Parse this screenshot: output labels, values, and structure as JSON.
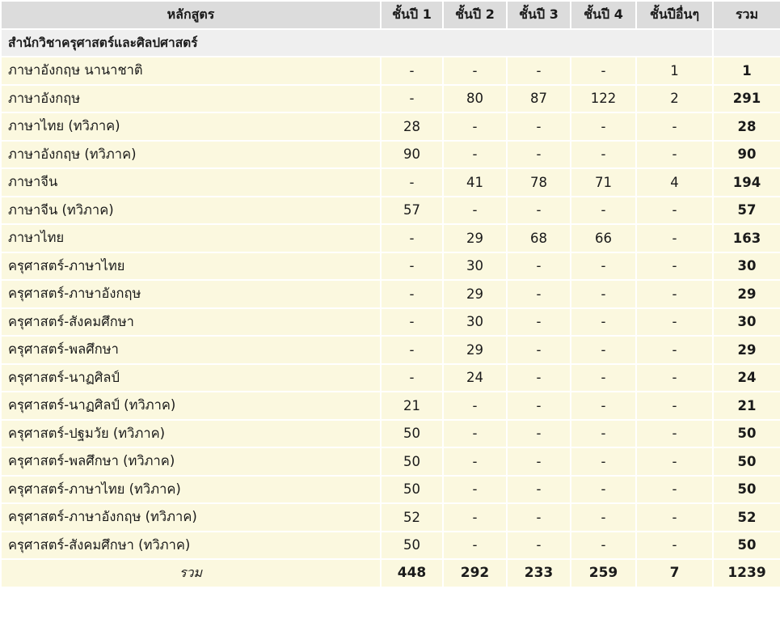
{
  "headers": [
    "หลักสูตร",
    "ชั้นปี 1",
    "ชั้นปี 2",
    "ชั้นปี 3",
    "ชั้นปี 4",
    "ชั้นปีอื่นๆ",
    "รวม"
  ],
  "section_title": "สำนักวิชาครุศาสตร์และศิลปศาสตร์",
  "rows": [
    {
      "program": "ภาษาอังกฤษ นานาชาติ",
      "y1": "-",
      "y2": "-",
      "y3": "-",
      "y4": "-",
      "other": "1",
      "total": "1"
    },
    {
      "program": "ภาษาอังกฤษ",
      "y1": "-",
      "y2": "80",
      "y3": "87",
      "y4": "122",
      "other": "2",
      "total": "291"
    },
    {
      "program": "ภาษาไทย (ทวิภาค)",
      "y1": "28",
      "y2": "-",
      "y3": "-",
      "y4": "-",
      "other": "-",
      "total": "28"
    },
    {
      "program": "ภาษาอังกฤษ (ทวิภาค)",
      "y1": "90",
      "y2": "-",
      "y3": "-",
      "y4": "-",
      "other": "-",
      "total": "90"
    },
    {
      "program": "ภาษาจีน",
      "y1": "-",
      "y2": "41",
      "y3": "78",
      "y4": "71",
      "other": "4",
      "total": "194"
    },
    {
      "program": "ภาษาจีน (ทวิภาค)",
      "y1": "57",
      "y2": "-",
      "y3": "-",
      "y4": "-",
      "other": "-",
      "total": "57"
    },
    {
      "program": "ภาษาไทย",
      "y1": "-",
      "y2": "29",
      "y3": "68",
      "y4": "66",
      "other": "-",
      "total": "163"
    },
    {
      "program": "ครุศาสตร์-ภาษาไทย",
      "y1": "-",
      "y2": "30",
      "y3": "-",
      "y4": "-",
      "other": "-",
      "total": "30"
    },
    {
      "program": "ครุศาสตร์-ภาษาอังกฤษ",
      "y1": "-",
      "y2": "29",
      "y3": "-",
      "y4": "-",
      "other": "-",
      "total": "29"
    },
    {
      "program": "ครุศาสตร์-สังคมศึกษา",
      "y1": "-",
      "y2": "30",
      "y3": "-",
      "y4": "-",
      "other": "-",
      "total": "30"
    },
    {
      "program": "ครุศาสตร์-พลศึกษา",
      "y1": "-",
      "y2": "29",
      "y3": "-",
      "y4": "-",
      "other": "-",
      "total": "29"
    },
    {
      "program": "ครุศาสตร์-นาฏศิลป์",
      "y1": "-",
      "y2": "24",
      "y3": "-",
      "y4": "-",
      "other": "-",
      "total": "24"
    },
    {
      "program": "ครุศาสตร์-นาฏศิลป์ (ทวิภาค)",
      "y1": "21",
      "y2": "-",
      "y3": "-",
      "y4": "-",
      "other": "-",
      "total": "21"
    },
    {
      "program": "ครุศาสตร์-ปฐมวัย (ทวิภาค)",
      "y1": "50",
      "y2": "-",
      "y3": "-",
      "y4": "-",
      "other": "-",
      "total": "50"
    },
    {
      "program": "ครุศาสตร์-พลศึกษา (ทวิภาค)",
      "y1": "50",
      "y2": "-",
      "y3": "-",
      "y4": "-",
      "other": "-",
      "total": "50"
    },
    {
      "program": "ครุศาสตร์-ภาษาไทย (ทวิภาค)",
      "y1": "50",
      "y2": "-",
      "y3": "-",
      "y4": "-",
      "other": "-",
      "total": "50"
    },
    {
      "program": "ครุศาสตร์-ภาษาอังกฤษ (ทวิภาค)",
      "y1": "52",
      "y2": "-",
      "y3": "-",
      "y4": "-",
      "other": "-",
      "total": "52"
    },
    {
      "program": "ครุศาสตร์-สังคมศึกษา (ทวิภาค)",
      "y1": "50",
      "y2": "-",
      "y3": "-",
      "y4": "-",
      "other": "-",
      "total": "50"
    }
  ],
  "totals": {
    "label": "รวม",
    "y1": "448",
    "y2": "292",
    "y3": "233",
    "y4": "259",
    "other": "7",
    "total": "1239"
  }
}
